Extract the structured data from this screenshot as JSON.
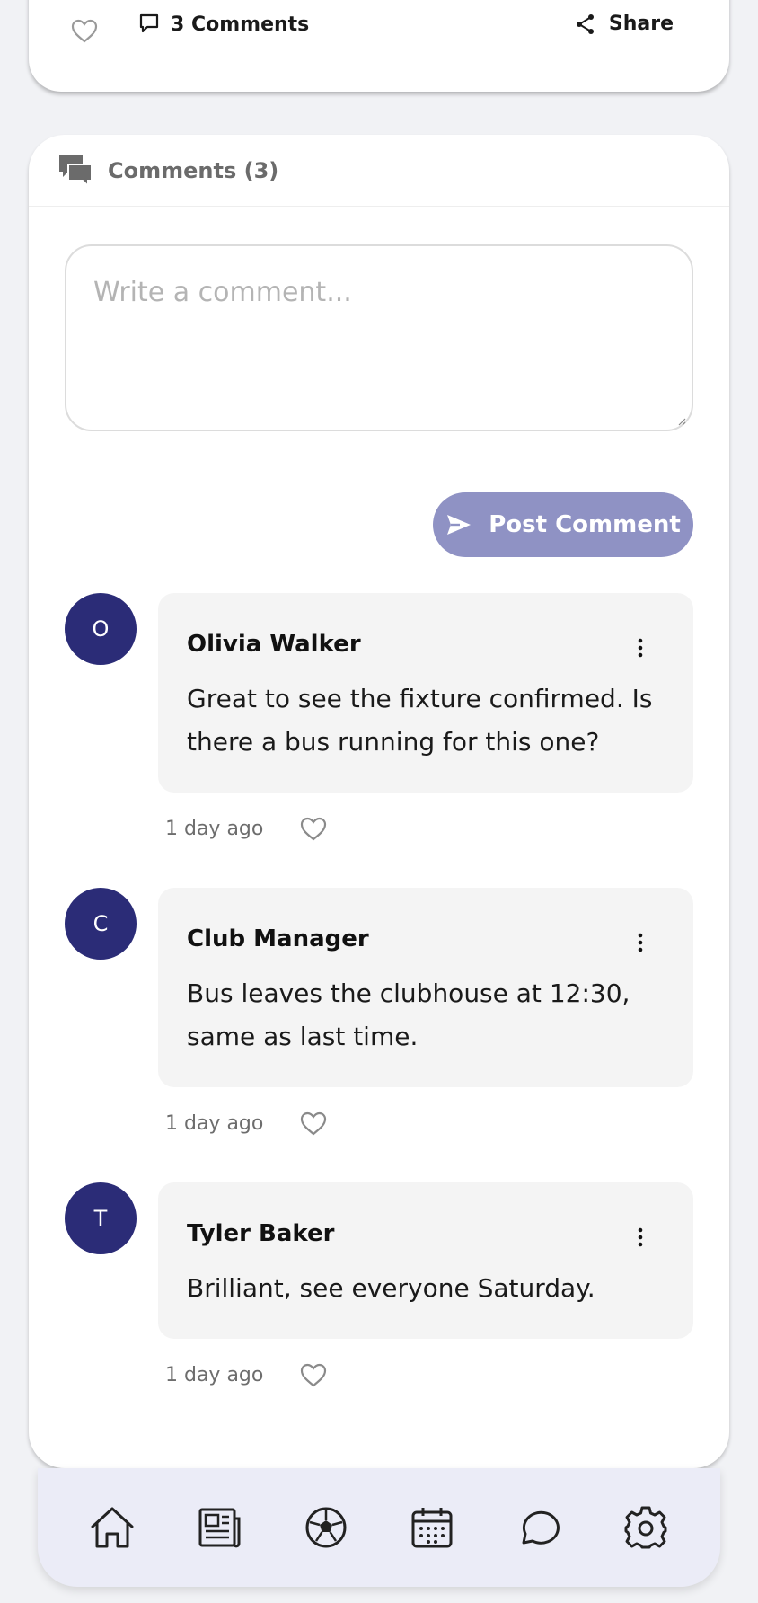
{
  "post_actions": {
    "like_icon": "heart-outline-icon",
    "comments_label": "3 Comments",
    "share_label": "Share"
  },
  "comments_section": {
    "header": "Comments (3)",
    "input_placeholder": "Write a comment...",
    "post_button_label": "Post Comment",
    "accent_color": "#2b2c77",
    "button_color": "#8f92c4",
    "comments": [
      {
        "initial": "O",
        "author": "Olivia Walker",
        "text": "Great to see the fixture confirmed. Is there a bus running for this one?",
        "time": "1 day ago"
      },
      {
        "initial": "C",
        "author": "Club Manager",
        "text": "Bus leaves the clubhouse at 12:30, same as last time.",
        "time": "1 day ago"
      },
      {
        "initial": "T",
        "author": "Tyler Baker",
        "text": "Brilliant, see everyone Saturday.",
        "time": "1 day ago"
      }
    ]
  },
  "bottom_nav": {
    "items": [
      "home-icon",
      "news-icon",
      "football-icon",
      "calendar-icon",
      "chat-icon",
      "settings-icon"
    ]
  }
}
